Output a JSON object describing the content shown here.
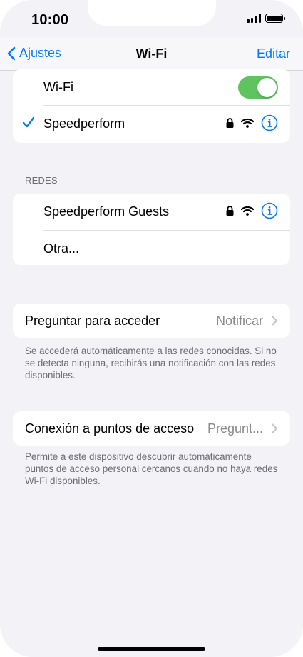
{
  "status_bar": {
    "time": "10:00"
  },
  "nav": {
    "back_label": "Ajustes",
    "title": "Wi-Fi",
    "edit_label": "Editar"
  },
  "wifi_toggle": {
    "label": "Wi-Fi",
    "on": true
  },
  "connected": {
    "name": "Speedperform",
    "secured": true
  },
  "networks": {
    "header": "REDES",
    "items": [
      {
        "name": "Speedperform Guests",
        "secured": true
      },
      {
        "name": "Otra..."
      }
    ]
  },
  "ask_join": {
    "label": "Preguntar para acceder",
    "value": "Notificar",
    "footer": "Se accederá automáticamente a las redes conocidas. Si no se detecta ninguna, recibirás una notificación con las redes disponibles."
  },
  "hotspot": {
    "label": "Conexión a puntos de acceso",
    "value": "Pregunt...",
    "footer": "Permite a este dispositivo descubrir automáticamente puntos de acceso personal cercanos cuando no haya redes Wi-Fi disponibles."
  },
  "colors": {
    "accent": "#007aff",
    "toggle_on": "#5fc35f",
    "background": "#f2f2f7"
  },
  "icons": [
    "back-chevron-icon",
    "checkmark-icon",
    "lock-icon",
    "wifi-icon",
    "info-icon",
    "chevron-right-icon",
    "signal-icon",
    "battery-icon"
  ]
}
